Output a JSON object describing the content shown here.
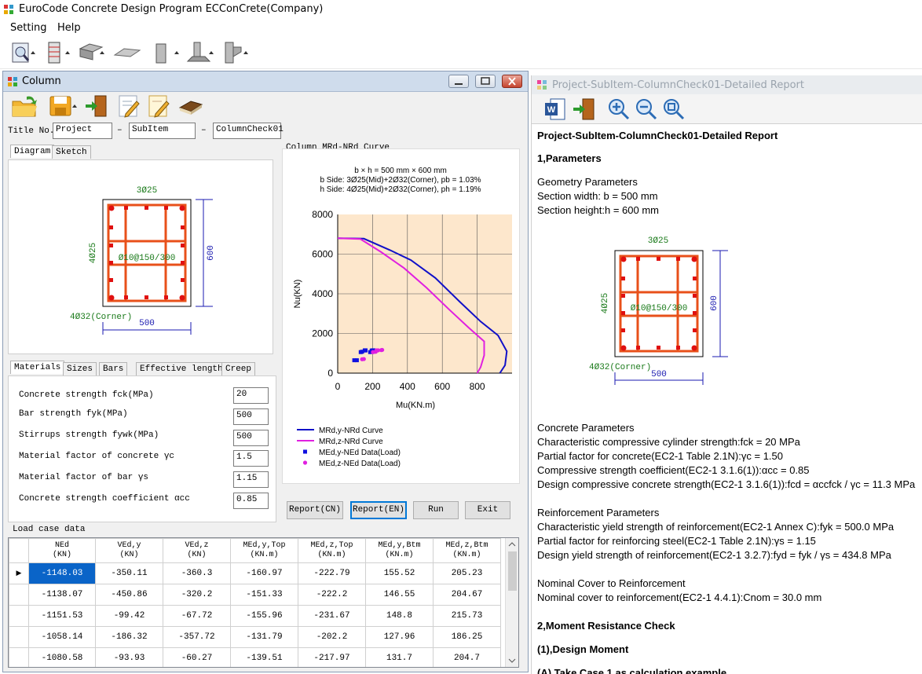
{
  "app": {
    "title": "EuroCode Concrete Design Program ECConCrete(Company)",
    "menu": [
      "Setting",
      "Help"
    ]
  },
  "column_window": {
    "title": "Column",
    "title_no_label": "Title No.",
    "title_fields": [
      "Project",
      "SubItem",
      "ColumnCheck01"
    ],
    "dash": "–",
    "diagram_tabs": [
      "Diagram",
      "Sketch"
    ],
    "section": {
      "top_bars": "3Ø25",
      "side_bars": "4Ø25",
      "stirrups": "Ø10@150/300",
      "corner": "4Ø32(Corner)",
      "width": "500",
      "height": "600"
    },
    "material_tabs": [
      "Materials",
      "Sizes",
      "Bars",
      "Effective length",
      "Creep"
    ],
    "materials": [
      {
        "label": "Concrete strength fck(MPa)",
        "value": "20"
      },
      {
        "label": "Bar strength fyk(MPa)",
        "value": "500"
      },
      {
        "label": "Stirrups strength fywk(MPa)",
        "value": "500"
      },
      {
        "label": "Material factor of concrete γc",
        "value": "1.5"
      },
      {
        "label": "Material factor of bar γs",
        "value": "1.15"
      },
      {
        "label": "Concrete strength coefficient αcc",
        "value": "0.85"
      }
    ],
    "curve_group_label": "Column MRd-NRd Curve",
    "buttons": [
      "Report(CN)",
      "Report(EN)",
      "Run",
      "Exit"
    ],
    "load_case_label": "Load case data",
    "grid": {
      "headers": [
        [
          "NEd",
          "(KN)"
        ],
        [
          "VEd,y",
          "(KN)"
        ],
        [
          "VEd,z",
          "(KN)"
        ],
        [
          "MEd,y,Top",
          "(KN.m)"
        ],
        [
          "MEd,z,Top",
          "(KN.m)"
        ],
        [
          "MEd,y,Btm",
          "(KN.m)"
        ],
        [
          "MEd,z,Btm",
          "(KN.m)"
        ]
      ],
      "rows": [
        [
          "-1148.03",
          "-350.11",
          "-360.3",
          "-160.97",
          "-222.79",
          "155.52",
          "205.23"
        ],
        [
          "-1138.07",
          "-450.86",
          "-320.2",
          "-151.33",
          "-222.2",
          "146.55",
          "204.67"
        ],
        [
          "-1151.53",
          "-99.42",
          "-67.72",
          "-155.96",
          "-231.67",
          "148.8",
          "215.73"
        ],
        [
          "-1058.14",
          "-186.32",
          "-357.72",
          "-131.79",
          "-202.2",
          "127.96",
          "186.25"
        ],
        [
          "-1080.58",
          "-93.93",
          "-60.27",
          "-139.51",
          "-217.97",
          "131.7",
          "204.7"
        ]
      ],
      "row_marker": "▶"
    }
  },
  "chart_data": {
    "type": "line",
    "title": "b × h = 500 mm × 600 mm",
    "subtitle": [
      "b Side: 3Ø25(Mid)+2Ø32(Corner), pb = 1.03%",
      "h Side: 4Ø25(Mid)+2Ø32(Corner), ph = 1.19%"
    ],
    "xlabel": "Mu(KN.m)",
    "ylabel": "Nu(KN)",
    "xlim": [
      0,
      1000
    ],
    "ylim": [
      0,
      8000
    ],
    "xticks": [
      "0",
      "200",
      "400",
      "600",
      "800"
    ],
    "yticks": [
      "0",
      "2000",
      "4000",
      "6000",
      "8000"
    ],
    "grid": true,
    "background": "#fde7cc",
    "series": [
      {
        "name": "MRd,y-NRd Curve",
        "color": "#1010c8",
        "kind": "line",
        "points": [
          [
            0,
            6800
          ],
          [
            150,
            6780
          ],
          [
            300,
            6200
          ],
          [
            420,
            5700
          ],
          [
            560,
            4800
          ],
          [
            700,
            3600
          ],
          [
            820,
            2600
          ],
          [
            920,
            1900
          ],
          [
            970,
            1100
          ],
          [
            960,
            400
          ],
          [
            930,
            0
          ]
        ]
      },
      {
        "name": "MRd,z-NRd Curve",
        "color": "#e020e0",
        "kind": "line",
        "points": [
          [
            0,
            6800
          ],
          [
            130,
            6760
          ],
          [
            250,
            6100
          ],
          [
            380,
            5300
          ],
          [
            510,
            4300
          ],
          [
            640,
            3200
          ],
          [
            750,
            2300
          ],
          [
            840,
            1600
          ],
          [
            840,
            900
          ],
          [
            820,
            300
          ],
          [
            800,
            0
          ]
        ]
      },
      {
        "name": "MEd,y-NEd Data(Load)",
        "color": "#1010e0",
        "kind": "scatter",
        "points": [
          [
            160,
            1150
          ],
          [
            155,
            1140
          ],
          [
            156,
            1150
          ],
          [
            132,
            1060
          ],
          [
            140,
            1080
          ],
          [
            200,
            1150
          ],
          [
            195,
            1140
          ],
          [
            205,
            1150
          ],
          [
            186,
            1060
          ],
          [
            204,
            1080
          ],
          [
            95,
            650
          ],
          [
            110,
            650
          ]
        ]
      },
      {
        "name": "MEd,z-NEd Data(Load)",
        "color": "#e020e0",
        "kind": "scatter",
        "points": [
          [
            223,
            1150
          ],
          [
            222,
            1140
          ],
          [
            232,
            1150
          ],
          [
            202,
            1060
          ],
          [
            218,
            1080
          ],
          [
            250,
            1160
          ],
          [
            255,
            1170
          ],
          [
            140,
            700
          ],
          [
            150,
            710
          ]
        ]
      }
    ],
    "legend": "bottom-left"
  },
  "report_window": {
    "title": "Project-SubItem-ColumnCheck01-Detailed Report",
    "lines": [
      {
        "text": "Project-SubItem-ColumnCheck01-Detailed Report",
        "bold": true
      },
      {
        "text": "1,Parameters",
        "bold": true
      },
      {
        "text": "Geometry Parameters",
        "bold": false
      },
      {
        "text": "Section width: b = 500 mm",
        "bold": false
      },
      {
        "text": "Section height:h = 600 mm",
        "bold": false
      },
      {
        "text": "Concrete Parameters",
        "bold": false
      },
      {
        "text": "Characteristic compressive cylinder strength:fck = 20 MPa",
        "bold": false
      },
      {
        "text": "Partial factor for concrete(EC2-1 Table 2.1N):γc = 1.50",
        "bold": false
      },
      {
        "text": "Compressive strength coefficient(EC2-1 3.1.6(1)):αcc = 0.85",
        "bold": false
      },
      {
        "text": "Design compressive concrete strength(EC2-1 3.1.6(1)):fcd = αccfck / γc = 11.3 MPa",
        "bold": false
      },
      {
        "text": "Reinforcement Parameters",
        "bold": false
      },
      {
        "text": "Characteristic yield strength of reinforcement(EC2-1 Annex C):fyk = 500.0 MPa",
        "bold": false
      },
      {
        "text": "Partial factor for reinforcing steel(EC2-1 Table 2.1N):γs = 1.15",
        "bold": false
      },
      {
        "text": "Design yield strength of reinforcement(EC2-1 3.2.7):fyd = fyk / γs = 434.8 MPa",
        "bold": false
      },
      {
        "text": "Nominal Cover to Reinforcement",
        "bold": false
      },
      {
        "text": "Nominal cover to reinforcement(EC2-1 4.4.1):Cnom = 30.0 mm",
        "bold": false
      },
      {
        "text": "2,Moment Resistance Check",
        "bold": true
      },
      {
        "text": "(1),Design Moment",
        "bold": true
      },
      {
        "text": "(A) Take Case 1 as calculation example",
        "bold": true
      }
    ],
    "section": {
      "top_bars": "3Ø25",
      "side_bars": "4Ø25",
      "stirrups": "Ø10@150/300",
      "corner": "4Ø32(Corner)",
      "width": "500",
      "height": "600"
    }
  }
}
